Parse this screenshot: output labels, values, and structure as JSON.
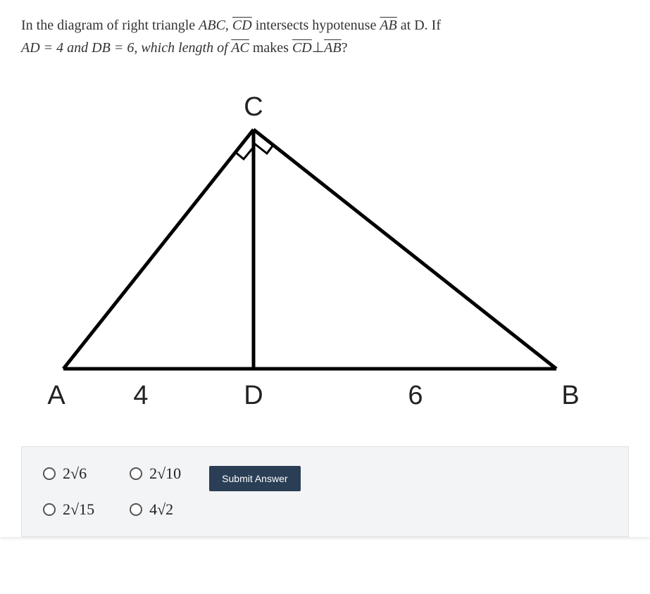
{
  "question": {
    "line1_pre": "In the diagram of right triangle ",
    "tri": "ABC",
    "line1_mid1": ", ",
    "seg_cd": "CD",
    "line1_mid2": " intersects hypotenuse ",
    "seg_ab": "AB",
    "line1_post": " at D. If",
    "line2_pre": "AD = 4 and DB = 6, which length of ",
    "seg_ac": "AC",
    "line2_mid": " makes ",
    "seg_cd2": "CD",
    "perp": "⊥",
    "seg_ab2": "AB",
    "line2_post": "?"
  },
  "diagram": {
    "A": "A",
    "B": "B",
    "C": "C",
    "D": "D",
    "val_ad": "4",
    "val_db": "6"
  },
  "options": {
    "opt1": "2√6",
    "opt2": "2√10",
    "opt3": "2√15",
    "opt4": "4√2"
  },
  "submit_label": "Submit Answer"
}
